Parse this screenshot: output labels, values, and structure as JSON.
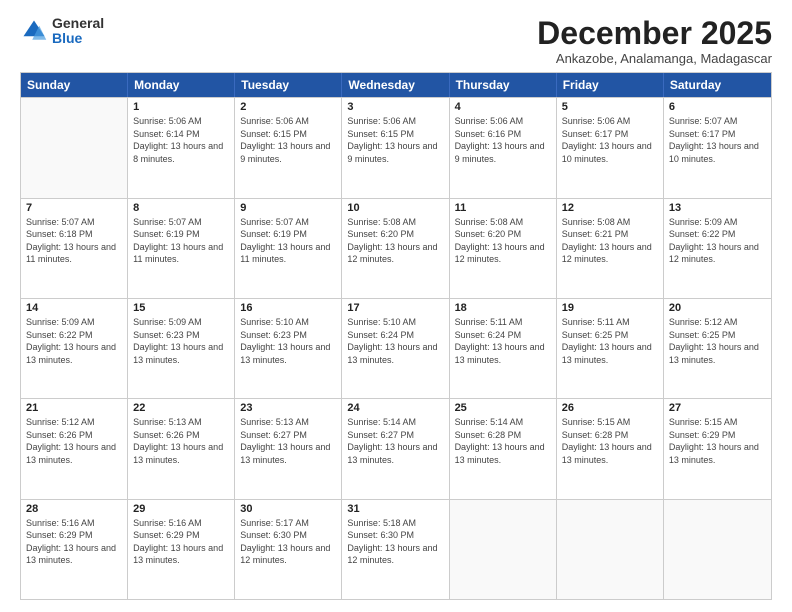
{
  "logo": {
    "general": "General",
    "blue": "Blue"
  },
  "title": "December 2025",
  "subtitle": "Ankazobe, Analamanga, Madagascar",
  "header_days": [
    "Sunday",
    "Monday",
    "Tuesday",
    "Wednesday",
    "Thursday",
    "Friday",
    "Saturday"
  ],
  "weeks": [
    [
      {
        "day": "",
        "sunrise": "",
        "sunset": "",
        "daylight": ""
      },
      {
        "day": "1",
        "sunrise": "Sunrise: 5:06 AM",
        "sunset": "Sunset: 6:14 PM",
        "daylight": "Daylight: 13 hours and 8 minutes."
      },
      {
        "day": "2",
        "sunrise": "Sunrise: 5:06 AM",
        "sunset": "Sunset: 6:15 PM",
        "daylight": "Daylight: 13 hours and 9 minutes."
      },
      {
        "day": "3",
        "sunrise": "Sunrise: 5:06 AM",
        "sunset": "Sunset: 6:15 PM",
        "daylight": "Daylight: 13 hours and 9 minutes."
      },
      {
        "day": "4",
        "sunrise": "Sunrise: 5:06 AM",
        "sunset": "Sunset: 6:16 PM",
        "daylight": "Daylight: 13 hours and 9 minutes."
      },
      {
        "day": "5",
        "sunrise": "Sunrise: 5:06 AM",
        "sunset": "Sunset: 6:17 PM",
        "daylight": "Daylight: 13 hours and 10 minutes."
      },
      {
        "day": "6",
        "sunrise": "Sunrise: 5:07 AM",
        "sunset": "Sunset: 6:17 PM",
        "daylight": "Daylight: 13 hours and 10 minutes."
      }
    ],
    [
      {
        "day": "7",
        "sunrise": "Sunrise: 5:07 AM",
        "sunset": "Sunset: 6:18 PM",
        "daylight": "Daylight: 13 hours and 11 minutes."
      },
      {
        "day": "8",
        "sunrise": "Sunrise: 5:07 AM",
        "sunset": "Sunset: 6:19 PM",
        "daylight": "Daylight: 13 hours and 11 minutes."
      },
      {
        "day": "9",
        "sunrise": "Sunrise: 5:07 AM",
        "sunset": "Sunset: 6:19 PM",
        "daylight": "Daylight: 13 hours and 11 minutes."
      },
      {
        "day": "10",
        "sunrise": "Sunrise: 5:08 AM",
        "sunset": "Sunset: 6:20 PM",
        "daylight": "Daylight: 13 hours and 12 minutes."
      },
      {
        "day": "11",
        "sunrise": "Sunrise: 5:08 AM",
        "sunset": "Sunset: 6:20 PM",
        "daylight": "Daylight: 13 hours and 12 minutes."
      },
      {
        "day": "12",
        "sunrise": "Sunrise: 5:08 AM",
        "sunset": "Sunset: 6:21 PM",
        "daylight": "Daylight: 13 hours and 12 minutes."
      },
      {
        "day": "13",
        "sunrise": "Sunrise: 5:09 AM",
        "sunset": "Sunset: 6:22 PM",
        "daylight": "Daylight: 13 hours and 12 minutes."
      }
    ],
    [
      {
        "day": "14",
        "sunrise": "Sunrise: 5:09 AM",
        "sunset": "Sunset: 6:22 PM",
        "daylight": "Daylight: 13 hours and 13 minutes."
      },
      {
        "day": "15",
        "sunrise": "Sunrise: 5:09 AM",
        "sunset": "Sunset: 6:23 PM",
        "daylight": "Daylight: 13 hours and 13 minutes."
      },
      {
        "day": "16",
        "sunrise": "Sunrise: 5:10 AM",
        "sunset": "Sunset: 6:23 PM",
        "daylight": "Daylight: 13 hours and 13 minutes."
      },
      {
        "day": "17",
        "sunrise": "Sunrise: 5:10 AM",
        "sunset": "Sunset: 6:24 PM",
        "daylight": "Daylight: 13 hours and 13 minutes."
      },
      {
        "day": "18",
        "sunrise": "Sunrise: 5:11 AM",
        "sunset": "Sunset: 6:24 PM",
        "daylight": "Daylight: 13 hours and 13 minutes."
      },
      {
        "day": "19",
        "sunrise": "Sunrise: 5:11 AM",
        "sunset": "Sunset: 6:25 PM",
        "daylight": "Daylight: 13 hours and 13 minutes."
      },
      {
        "day": "20",
        "sunrise": "Sunrise: 5:12 AM",
        "sunset": "Sunset: 6:25 PM",
        "daylight": "Daylight: 13 hours and 13 minutes."
      }
    ],
    [
      {
        "day": "21",
        "sunrise": "Sunrise: 5:12 AM",
        "sunset": "Sunset: 6:26 PM",
        "daylight": "Daylight: 13 hours and 13 minutes."
      },
      {
        "day": "22",
        "sunrise": "Sunrise: 5:13 AM",
        "sunset": "Sunset: 6:26 PM",
        "daylight": "Daylight: 13 hours and 13 minutes."
      },
      {
        "day": "23",
        "sunrise": "Sunrise: 5:13 AM",
        "sunset": "Sunset: 6:27 PM",
        "daylight": "Daylight: 13 hours and 13 minutes."
      },
      {
        "day": "24",
        "sunrise": "Sunrise: 5:14 AM",
        "sunset": "Sunset: 6:27 PM",
        "daylight": "Daylight: 13 hours and 13 minutes."
      },
      {
        "day": "25",
        "sunrise": "Sunrise: 5:14 AM",
        "sunset": "Sunset: 6:28 PM",
        "daylight": "Daylight: 13 hours and 13 minutes."
      },
      {
        "day": "26",
        "sunrise": "Sunrise: 5:15 AM",
        "sunset": "Sunset: 6:28 PM",
        "daylight": "Daylight: 13 hours and 13 minutes."
      },
      {
        "day": "27",
        "sunrise": "Sunrise: 5:15 AM",
        "sunset": "Sunset: 6:29 PM",
        "daylight": "Daylight: 13 hours and 13 minutes."
      }
    ],
    [
      {
        "day": "28",
        "sunrise": "Sunrise: 5:16 AM",
        "sunset": "Sunset: 6:29 PM",
        "daylight": "Daylight: 13 hours and 13 minutes."
      },
      {
        "day": "29",
        "sunrise": "Sunrise: 5:16 AM",
        "sunset": "Sunset: 6:29 PM",
        "daylight": "Daylight: 13 hours and 13 minutes."
      },
      {
        "day": "30",
        "sunrise": "Sunrise: 5:17 AM",
        "sunset": "Sunset: 6:30 PM",
        "daylight": "Daylight: 13 hours and 12 minutes."
      },
      {
        "day": "31",
        "sunrise": "Sunrise: 5:18 AM",
        "sunset": "Sunset: 6:30 PM",
        "daylight": "Daylight: 13 hours and 12 minutes."
      },
      {
        "day": "",
        "sunrise": "",
        "sunset": "",
        "daylight": ""
      },
      {
        "day": "",
        "sunrise": "",
        "sunset": "",
        "daylight": ""
      },
      {
        "day": "",
        "sunrise": "",
        "sunset": "",
        "daylight": ""
      }
    ]
  ]
}
